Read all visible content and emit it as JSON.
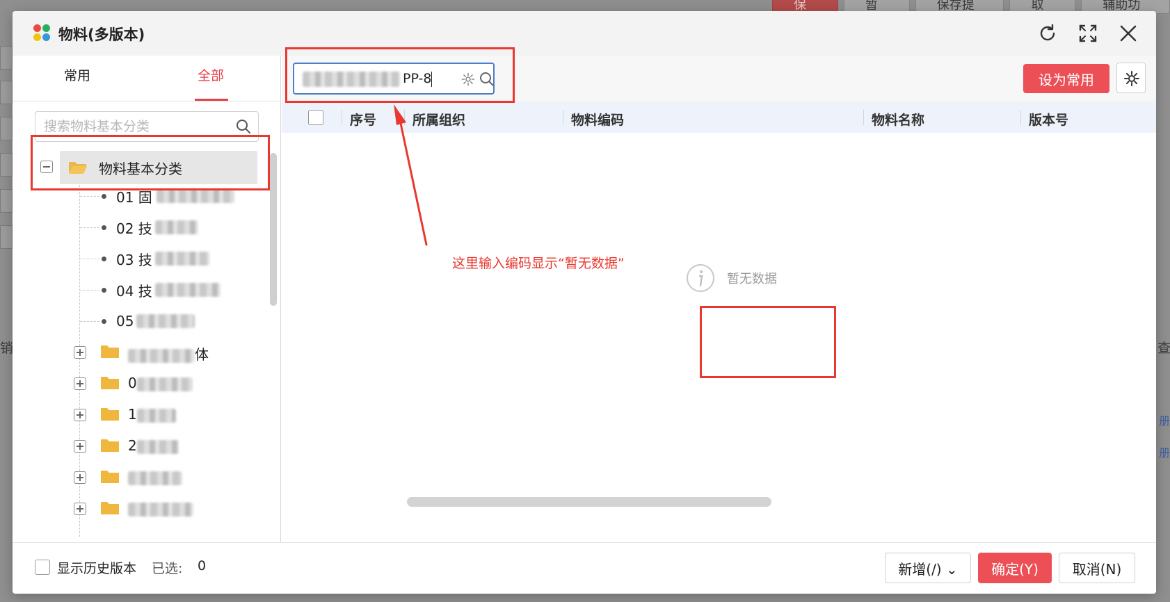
{
  "background": {
    "toolbar_buttons": [
      "保存",
      "暂存",
      "保存提交",
      "取消",
      "辅助功能"
    ],
    "side_texts": [
      "销",
      "查",
      "册",
      "册"
    ]
  },
  "dialog": {
    "title": "物料(多版本)",
    "header_icons": [
      "refresh-icon",
      "fullscreen-icon",
      "close-icon"
    ]
  },
  "left": {
    "tabs": [
      {
        "label": "常用",
        "active": false
      },
      {
        "label": "全部",
        "active": true
      }
    ],
    "search": {
      "placeholder": "搜索物料基本分类"
    },
    "tree": {
      "root_label": "物料基本分类",
      "leaves": [
        {
          "label": "01 固"
        },
        {
          "label": "02 技"
        },
        {
          "label": "03 技"
        },
        {
          "label": "04 技"
        },
        {
          "label": "05"
        }
      ],
      "folders": [
        {
          "label": "体"
        },
        {
          "label": "0"
        },
        {
          "label": "1"
        },
        {
          "label": "2"
        },
        {
          "label": ""
        },
        {
          "label": ""
        }
      ]
    }
  },
  "right": {
    "search_value_visible": "PP-8",
    "set_common_label": "设为常用",
    "columns": [
      "序号",
      "所属组织",
      "物料编码",
      "物料名称",
      "版本号"
    ],
    "empty_text": "暂无数据"
  },
  "footer": {
    "history_label": "显示历史版本",
    "selected_label": "已选:",
    "selected_count": "0",
    "add_label": "新增(/)",
    "ok_label": "确定(Y)",
    "cancel_label": "取消(N)"
  },
  "annotation": {
    "note": "这里输入编码显示“暂无数据”"
  },
  "colors": {
    "accent": "#ec4f55",
    "annotation": "#e8382f",
    "input_focus": "#4a7ec9"
  }
}
